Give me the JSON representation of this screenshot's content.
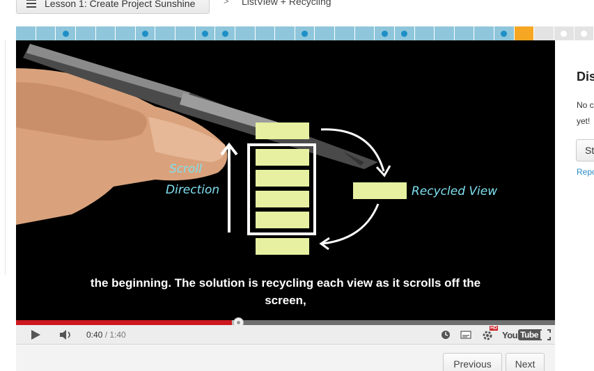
{
  "breadcrumb": {
    "lesson_label": "Lesson 1: Create Project Sunshine",
    "separator": ">",
    "current": "ListView + Recycling"
  },
  "progress": {
    "segments": [
      {
        "state": "done",
        "dot": false
      },
      {
        "state": "done",
        "dot": false
      },
      {
        "state": "done",
        "dot": true
      },
      {
        "state": "done",
        "dot": false
      },
      {
        "state": "done",
        "dot": false
      },
      {
        "state": "done",
        "dot": false
      },
      {
        "state": "done",
        "dot": true
      },
      {
        "state": "done",
        "dot": false
      },
      {
        "state": "done",
        "dot": false
      },
      {
        "state": "done",
        "dot": true
      },
      {
        "state": "done",
        "dot": true
      },
      {
        "state": "done",
        "dot": false
      },
      {
        "state": "done",
        "dot": false
      },
      {
        "state": "done",
        "dot": false
      },
      {
        "state": "done",
        "dot": true
      },
      {
        "state": "done",
        "dot": false
      },
      {
        "state": "done",
        "dot": false
      },
      {
        "state": "done",
        "dot": false
      },
      {
        "state": "done",
        "dot": true
      },
      {
        "state": "done",
        "dot": true
      },
      {
        "state": "done",
        "dot": false
      },
      {
        "state": "done",
        "dot": false
      },
      {
        "state": "done",
        "dot": false
      },
      {
        "state": "done",
        "dot": false
      },
      {
        "state": "done",
        "dot": true
      },
      {
        "state": "current",
        "dot": false
      },
      {
        "state": "todo",
        "dot": false
      },
      {
        "state": "todo",
        "dot": true
      },
      {
        "state": "todo",
        "dot": true
      }
    ],
    "colors": {
      "done": "#8fc6db",
      "current": "#f5a623",
      "todo": "#e3e3e3",
      "dot": "#1e8fc6"
    }
  },
  "video": {
    "whiteboard": {
      "scroll_label_line1": "Scroll",
      "scroll_label_line2": "Direction",
      "recycled_label": "Recycled View"
    },
    "caption_line1": "the beginning. The solution is recycling each view as it scrolls off the",
    "caption_line2": "screen,"
  },
  "player": {
    "current_time": "0:40",
    "separator": " / ",
    "duration": "1:40",
    "played_fraction": 0.4,
    "buffered_fraction": 0.42,
    "hd_badge": "HD",
    "logo_you": "You",
    "logo_tube": "Tube",
    "icons": [
      "play-icon",
      "volume-icon",
      "watch-later-icon",
      "captions-icon",
      "settings-icon",
      "fullscreen-icon"
    ]
  },
  "navigation": {
    "previous_label": "Previous",
    "next_label": "Next"
  },
  "discussion": {
    "title": "Dis",
    "empty_text_line1": "No c",
    "empty_text_line2": "yet!",
    "start_button": "St",
    "report_link": "Repo"
  }
}
